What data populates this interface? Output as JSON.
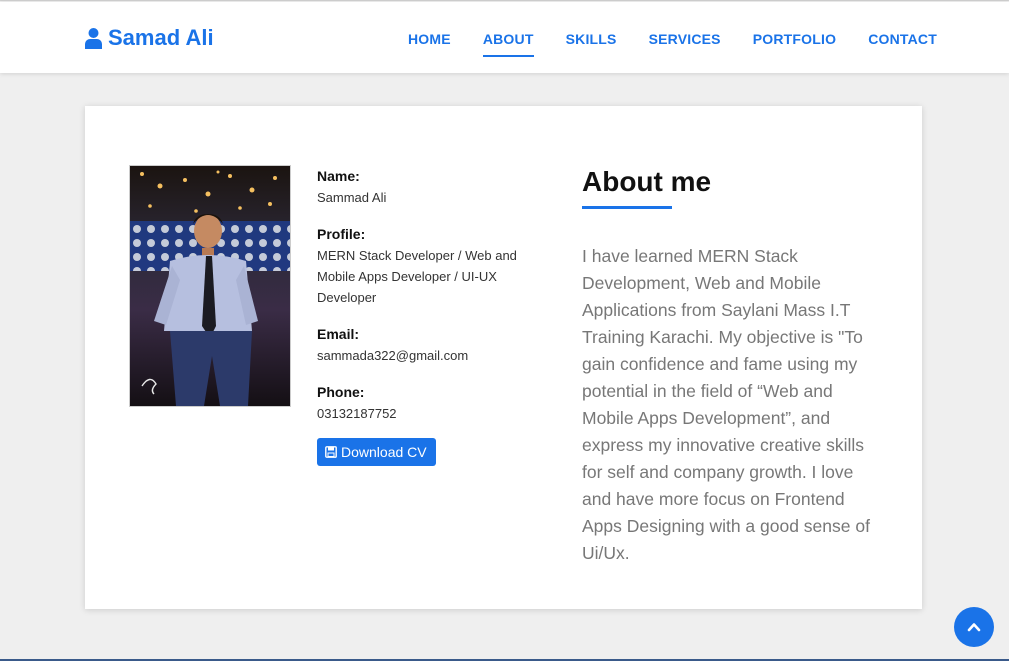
{
  "brand": {
    "name": "Samad Ali",
    "icon": "user-icon"
  },
  "nav": {
    "items": [
      {
        "label": "HOME"
      },
      {
        "label": "ABOUT",
        "active": true
      },
      {
        "label": "SKILLS"
      },
      {
        "label": "SERVICES"
      },
      {
        "label": "PORTFOLIO"
      },
      {
        "label": "CONTACT"
      }
    ]
  },
  "profile": {
    "name_label": "Name:",
    "name_value": "Sammad Ali",
    "profile_label": "Profile:",
    "profile_value": "MERN Stack Developer / Web and Mobile Apps Developer / UI-UX Developer",
    "email_label": "Email:",
    "email_value": "sammada322@gmail.com",
    "phone_label": "Phone:",
    "phone_value": "03132187752",
    "download_label": "Download CV",
    "download_icon": "save-icon"
  },
  "about": {
    "heading": "About me",
    "text": "I have learned MERN Stack Development, Web and Mobile Applications from Saylani Mass I.T Training Karachi. My objective is \"To gain confidence and fame using my potential in the field of “Web and Mobile Apps Development”, and express my innovative creative skills for self and company growth. I love and have more focus on Frontend Apps Designing with a good sense of Ui/Ux."
  },
  "scroll_top_icon": "chevron-up-icon",
  "colors": {
    "accent": "#1a73e8",
    "background": "#efefef",
    "card": "#ffffff"
  }
}
